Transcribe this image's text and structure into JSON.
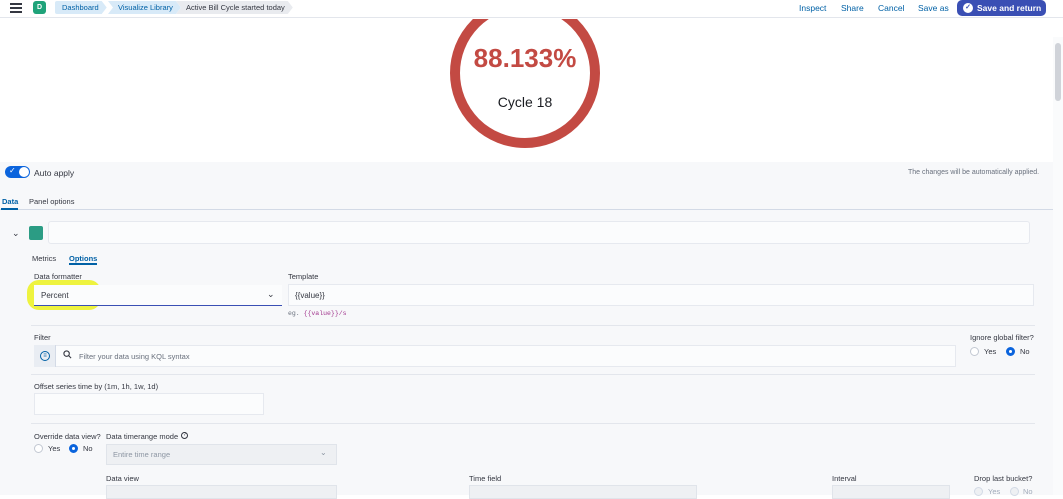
{
  "header": {
    "space_initial": "D",
    "breadcrumbs": [
      "Dashboard",
      "Visualize Library",
      "Active Bill Cycle started today"
    ],
    "links": {
      "inspect": "Inspect",
      "share": "Share",
      "cancel": "Cancel",
      "save_as": "Save as"
    },
    "save_return": "Save and return"
  },
  "visualization": {
    "type": "gauge",
    "value": "88.133%",
    "label": "Cycle 18",
    "fraction": 0.88133,
    "color": "#c34a43"
  },
  "editor": {
    "auto_apply_label": "Auto apply",
    "auto_apply_on": true,
    "auto_note": "The changes will be automatically applied.",
    "tabs": [
      "Data",
      "Panel options"
    ],
    "series": {
      "color": "#2b9c84",
      "subtabs": [
        "Metrics",
        "Options"
      ],
      "data_formatter_label": "Data formatter",
      "data_formatter_value": "Percent",
      "template_label": "Template",
      "template_value": "{{value}}",
      "template_hint_prefix": "eg.",
      "template_hint_code": "{{value}}/s",
      "filter_label": "Filter",
      "filter_placeholder": "Filter your data using KQL syntax",
      "ignore_global_label": "Ignore global filter?",
      "yes": "Yes",
      "no": "No",
      "offset_label": "Offset series time by (1m, 1h, 1w, 1d)",
      "override_label": "Override data view?",
      "timerange_label": "Data timerange mode",
      "timerange_value": "Entire time range",
      "data_view_label": "Data view",
      "time_field_label": "Time field",
      "interval_label": "Interval",
      "drop_last_label": "Drop last bucket?"
    }
  }
}
